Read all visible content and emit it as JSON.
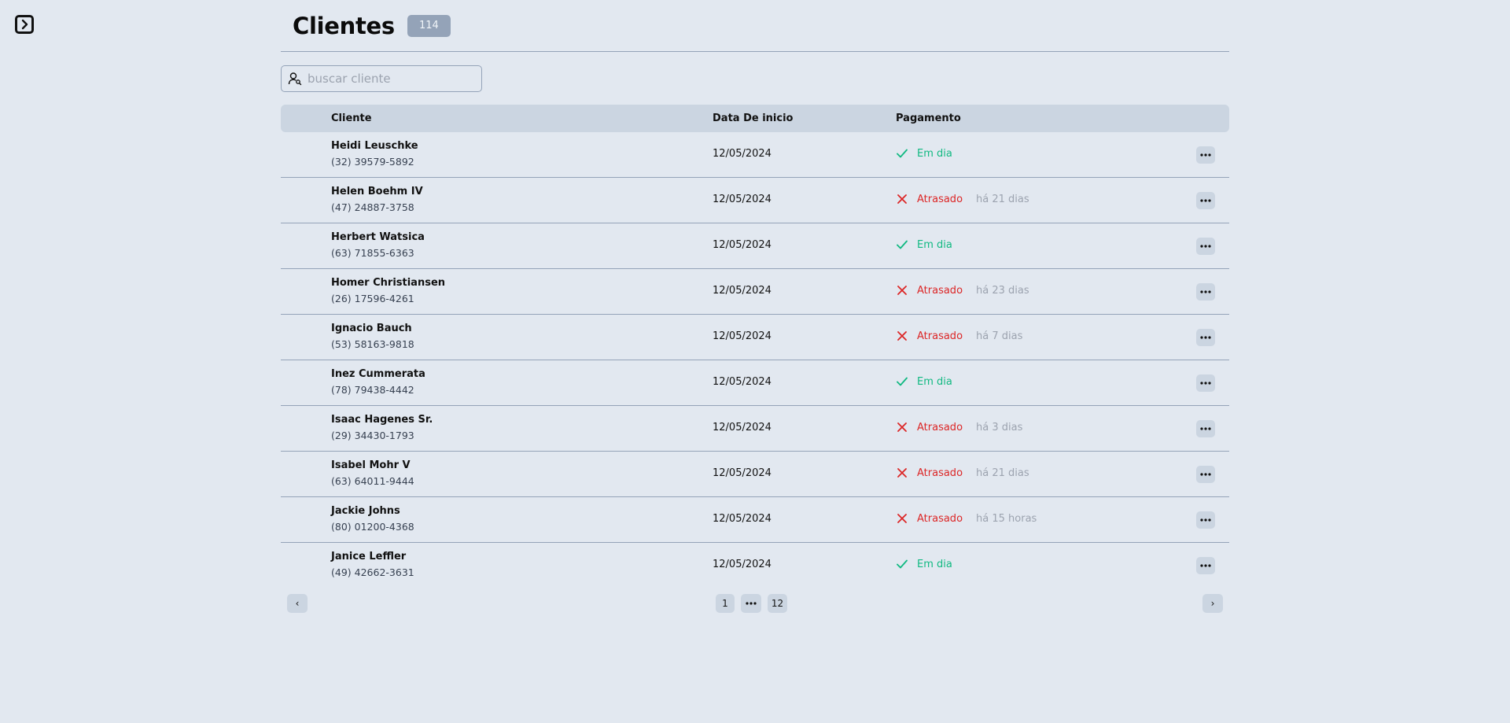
{
  "page": {
    "title": "Clientes",
    "count": "114"
  },
  "search": {
    "placeholder": "buscar cliente",
    "value": ""
  },
  "table": {
    "headers": {
      "client": "Cliente",
      "date": "Data De inicio",
      "payment": "Pagamento"
    },
    "rows": [
      {
        "name": "Heidi Leuschke",
        "phone": "(32) 39579-5892",
        "date": "12/05/2024",
        "status": "Em dia",
        "state": "ok",
        "since": ""
      },
      {
        "name": "Helen Boehm IV",
        "phone": "(47) 24887-3758",
        "date": "12/05/2024",
        "status": "Atrasado",
        "state": "late",
        "since": "há 21 dias"
      },
      {
        "name": "Herbert Watsica",
        "phone": "(63) 71855-6363",
        "date": "12/05/2024",
        "status": "Em dia",
        "state": "ok",
        "since": ""
      },
      {
        "name": "Homer Christiansen",
        "phone": "(26) 17596-4261",
        "date": "12/05/2024",
        "status": "Atrasado",
        "state": "late",
        "since": "há 23 dias"
      },
      {
        "name": "Ignacio Bauch",
        "phone": "(53) 58163-9818",
        "date": "12/05/2024",
        "status": "Atrasado",
        "state": "late",
        "since": "há 7 dias"
      },
      {
        "name": "Inez Cummerata",
        "phone": "(78) 79438-4442",
        "date": "12/05/2024",
        "status": "Em dia",
        "state": "ok",
        "since": ""
      },
      {
        "name": "Isaac Hagenes Sr.",
        "phone": "(29) 34430-1793",
        "date": "12/05/2024",
        "status": "Atrasado",
        "state": "late",
        "since": "há 3 dias"
      },
      {
        "name": "Isabel Mohr V",
        "phone": "(63) 64011-9444",
        "date": "12/05/2024",
        "status": "Atrasado",
        "state": "late",
        "since": "há 21 dias"
      },
      {
        "name": "Jackie Johns",
        "phone": "(80) 01200-4368",
        "date": "12/05/2024",
        "status": "Atrasado",
        "state": "late",
        "since": "há 15 horas"
      },
      {
        "name": "Janice Leffler",
        "phone": "(49) 42662-3631",
        "date": "12/05/2024",
        "status": "Em dia",
        "state": "ok",
        "since": ""
      }
    ]
  },
  "pagination": {
    "prev": "‹",
    "next": "›",
    "pages": [
      "1",
      "12"
    ]
  },
  "icons": {
    "sidebar_toggle": "chevron-right-icon",
    "search": "user-search-icon",
    "ok": "check-icon",
    "late": "x-icon",
    "more": "more-horizontal-icon",
    "ellipsis": "ellipsis-icon"
  },
  "colors": {
    "ok": "#10b981",
    "late": "#dc2626",
    "muted": "#9ca3af",
    "badge": "#94a3b8",
    "header_bg": "#cbd5e1",
    "page_bg": "#e2e8f0"
  }
}
